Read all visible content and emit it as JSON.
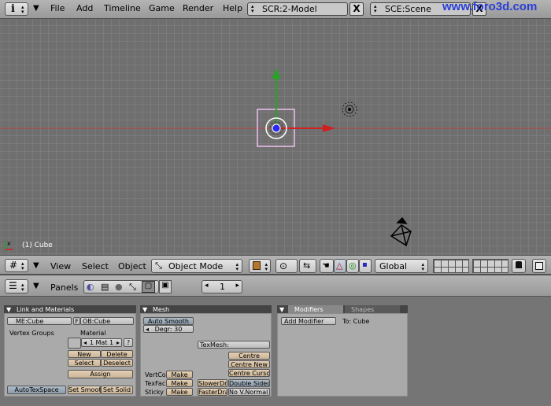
{
  "topbar": {
    "menus": [
      "File",
      "Add",
      "Timeline",
      "Game",
      "Render",
      "Help"
    ],
    "screen_field": "SCR:2-Model",
    "scene_field": "SCE:Scene",
    "close_x": "X",
    "watermark": "www.foro3d.com"
  },
  "viewport": {
    "object_label": "(1) Cube",
    "axes_label": "x"
  },
  "view3d_header": {
    "menus": [
      "View",
      "Select",
      "Object"
    ],
    "mode_select": "Object Mode",
    "orientation_select": "Global"
  },
  "buttons_header": {
    "panels_label": "Panels",
    "frame_number": "1"
  },
  "panel_links": {
    "title": "Link and Materials",
    "me_field": "ME:Cube",
    "f_label": "F",
    "ob_field": "OB:Cube",
    "vertex_groups": "Vertex Groups",
    "material_label": "Material",
    "mat_field": "1 Mat 1",
    "question": "?",
    "new": "New",
    "delete": "Delete",
    "select": "Select",
    "deselect": "Deselect",
    "assign": "Assign",
    "autotexspace": "AutoTexSpace",
    "set_smooth": "Set Smoot",
    "set_solid": "Set Solid"
  },
  "panel_mesh": {
    "title": "Mesh",
    "auto_smooth": "Auto Smooth",
    "degr": "Degr: 30",
    "texmesh": "TexMesh:",
    "centre": "Centre",
    "centre_new": "Centre New",
    "centre_cursor": "Centre Cursor",
    "vertco": "VertCo",
    "texfac": "TexFac",
    "sticky": "Sticky",
    "make": "Make",
    "slowerdraw": "SlowerDra",
    "fasterdraw": "FasterDra",
    "double_sided": "Double Sided",
    "no_vnormal": "No V.Normal Fl"
  },
  "panel_modifiers": {
    "tab_modifiers": "Modifiers",
    "tab_shapes": "Shapes",
    "add_modifier": "Add Modifier",
    "to_cube": "To: Cube"
  }
}
